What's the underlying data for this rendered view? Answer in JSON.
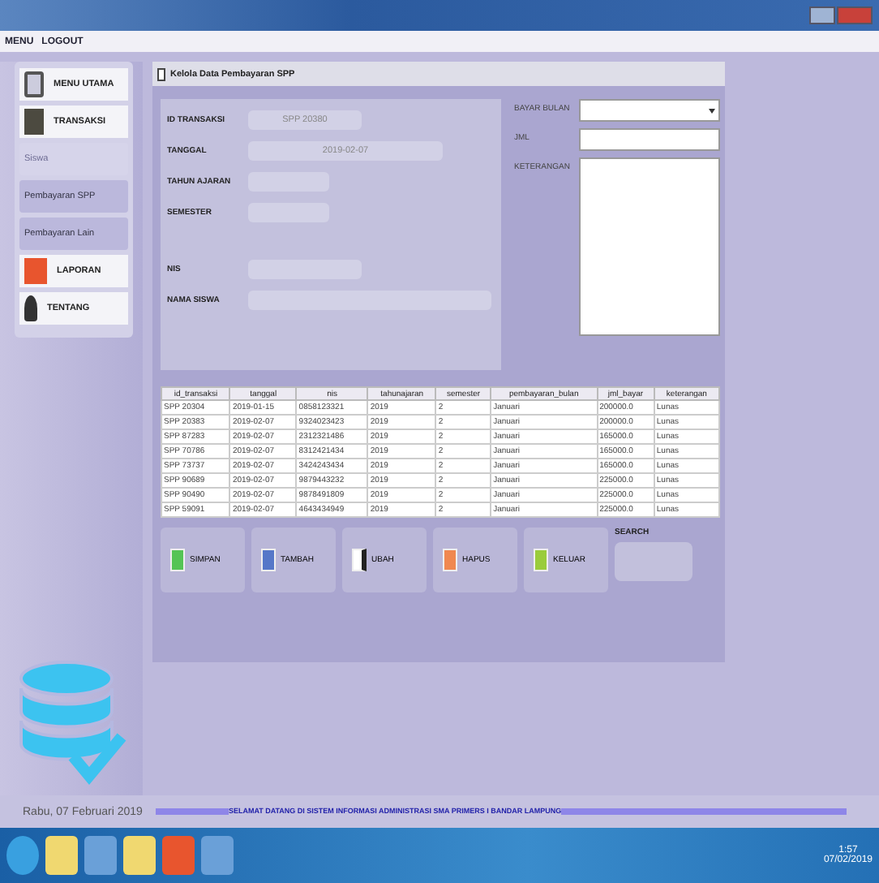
{
  "menu": [
    "MENU",
    "LOGOUT"
  ],
  "sidebar": {
    "items": [
      {
        "label": "MENU UTAMA",
        "kind": "section"
      },
      {
        "label": "TRANSAKSI",
        "kind": "section"
      },
      {
        "label": "Siswa",
        "kind": "sub",
        "disabled": true
      },
      {
        "label": "Pembayaran SPP",
        "kind": "sub",
        "disabled": false
      },
      {
        "label": "Pembayaran Lain",
        "kind": "sub",
        "disabled": false
      },
      {
        "label": "LAPORAN",
        "kind": "section"
      },
      {
        "label": "TENTANG",
        "kind": "section"
      }
    ]
  },
  "panel": {
    "title": "Kelola Data Pembayaran SPP",
    "fields": [
      {
        "label": "ID TRANSAKSI",
        "value": "SPP 20380"
      },
      {
        "label": "TANGGAL",
        "value": "2019-02-07"
      },
      {
        "label": "TAHUN AJARAN"
      },
      {
        "label": "SEMESTER"
      },
      {
        "label": "NIS"
      },
      {
        "label": "NAMA SISWA"
      }
    ],
    "side_fields": [
      {
        "label": "BAYAR BULAN",
        "kind": "select"
      },
      {
        "label": "JML",
        "kind": "input"
      },
      {
        "label": "KETERANGAN",
        "kind": "textarea"
      }
    ],
    "table": {
      "columns": [
        "id_transaksi",
        "tanggal",
        "nis",
        "tahunajaran",
        "semester",
        "pembayaran_bulan",
        "jml_bayar",
        "keterangan"
      ],
      "rows": [
        [
          "SPP 20304",
          "2019-01-15",
          "0858123321",
          "2019",
          "2",
          "Januari",
          "200000.0",
          "Lunas"
        ],
        [
          "SPP 20383",
          "2019-02-07",
          "9324023423",
          "2019",
          "2",
          "Januari",
          "200000.0",
          "Lunas"
        ],
        [
          "SPP 87283",
          "2019-02-07",
          "2312321486",
          "2019",
          "2",
          "Januari",
          "165000.0",
          "Lunas"
        ],
        [
          "SPP 70786",
          "2019-02-07",
          "8312421434",
          "2019",
          "2",
          "Januari",
          "165000.0",
          "Lunas"
        ],
        [
          "SPP 73737",
          "2019-02-07",
          "3424243434",
          "2019",
          "2",
          "Januari",
          "165000.0",
          "Lunas"
        ],
        [
          "SPP 90689",
          "2019-02-07",
          "9879443232",
          "2019",
          "2",
          "Januari",
          "225000.0",
          "Lunas"
        ],
        [
          "SPP 90490",
          "2019-02-07",
          "9878491809",
          "2019",
          "2",
          "Januari",
          "225000.0",
          "Lunas"
        ],
        [
          "SPP 59091",
          "2019-02-07",
          "4643434949",
          "2019",
          "2",
          "Januari",
          "225000.0",
          "Lunas"
        ]
      ]
    },
    "buttons": [
      {
        "label": "SIMPAN",
        "kind": "save"
      },
      {
        "label": "TAMBAH",
        "kind": "add"
      },
      {
        "label": "UBAH",
        "kind": "edit"
      },
      {
        "label": "HAPUS",
        "kind": "delete"
      },
      {
        "label": "KELUAR",
        "kind": "exit"
      }
    ],
    "search": {
      "label": "SEARCH"
    }
  },
  "status_bar": {
    "date": "Rabu, 07 Februari 2019",
    "marquee": "SELAMAT DATANG DI SISTEM INFORMASI ADMINISTRASI SMA PRIMERS I BANDAR LAMPUNG"
  },
  "taskbar": {
    "time": "1:57",
    "date": "07/02/2019"
  }
}
